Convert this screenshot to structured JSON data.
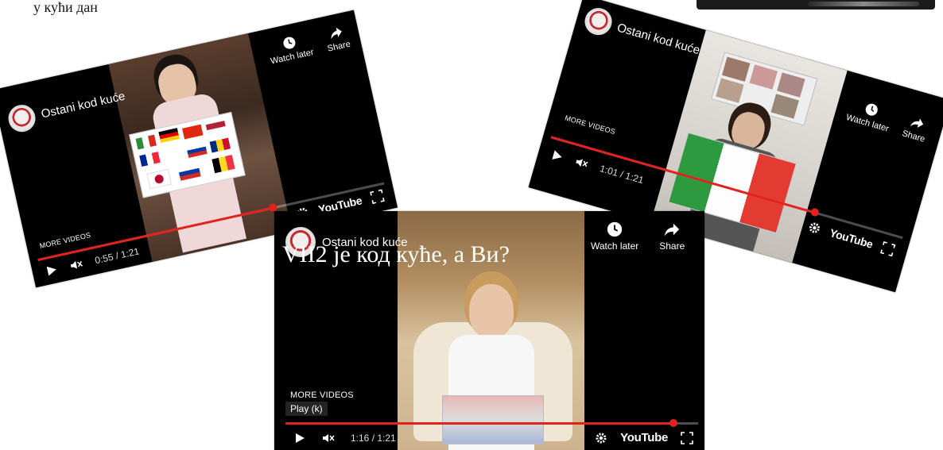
{
  "page": {
    "doc_fragment": "у кући дан"
  },
  "players": {
    "left": {
      "title": "Ostani kod kuće",
      "watch_later": "Watch later",
      "share": "Share",
      "more_videos": "MORE VIDEOS",
      "time": "0:55 / 1:21",
      "youtube": "YouTube",
      "progress": 0.68
    },
    "right": {
      "title": "Ostani kod kuće",
      "watch_later": "Watch later",
      "share": "Share",
      "more_videos": "MORE VIDEOS",
      "time": "1:01 / 1:21",
      "youtube": "YouTube",
      "progress": 0.75
    },
    "center": {
      "title": "Ostani kod kuće",
      "overlay": "VII2 је код куће, а Ви?",
      "watch_later": "Watch later",
      "share": "Share",
      "more_videos": "MORE VIDEOS",
      "tooltip": "Play (k)",
      "time": "1:16 / 1:21",
      "youtube": "YouTube",
      "progress": 0.94
    }
  },
  "icons": [
    "clock-icon",
    "share-arrow-icon",
    "play-icon",
    "mute-icon",
    "settings-gear-icon",
    "fullscreen-icon"
  ],
  "colors": {
    "progress_red": "#e1231f",
    "player_bg": "#000000"
  }
}
